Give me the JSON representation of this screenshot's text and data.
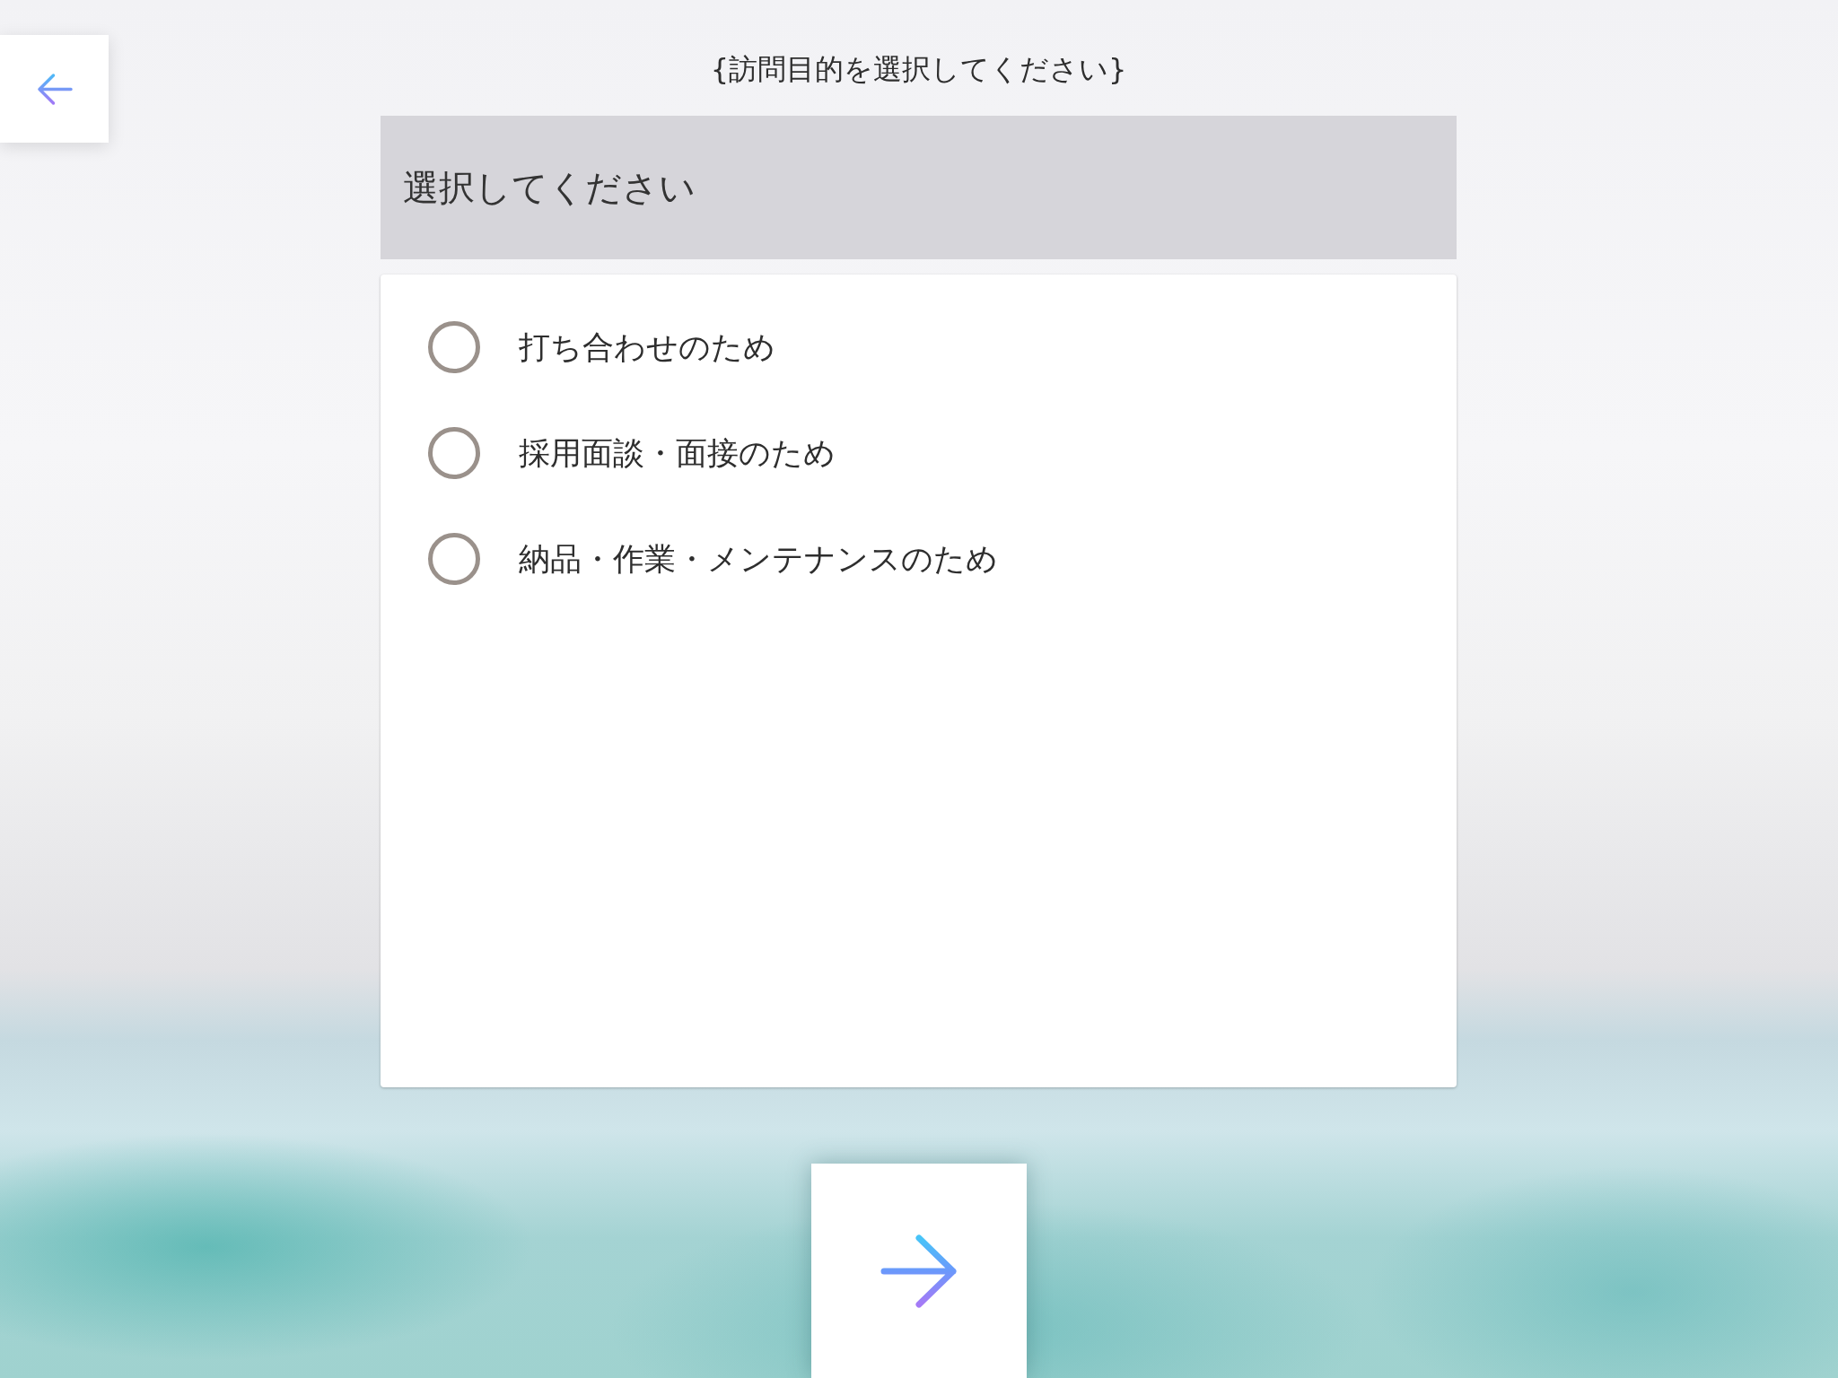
{
  "title": "{訪問目的を選択してください}",
  "dropdown": {
    "label": "選択してください"
  },
  "options": [
    {
      "label": "打ち合わせのため",
      "selected": false
    },
    {
      "label": "採用面談・面接のため",
      "selected": false
    },
    {
      "label": "納品・作業・メンテナンスのため",
      "selected": false
    }
  ]
}
